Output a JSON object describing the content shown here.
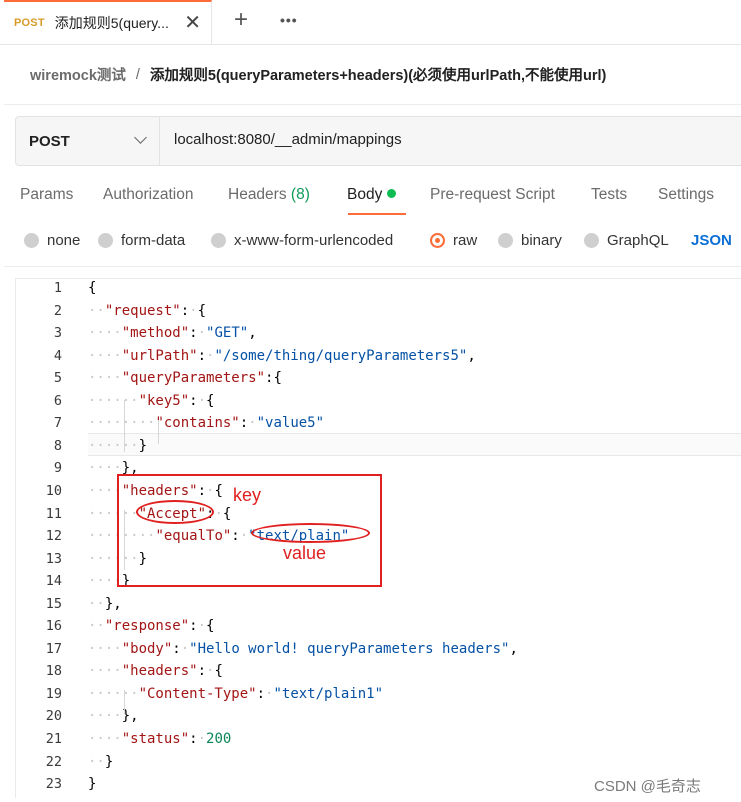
{
  "tab": {
    "method": "POST",
    "title": "添加规则5(query..."
  },
  "breadcrumb": {
    "parent": "wiremock测试",
    "separator": "/",
    "current": "添加规则5(queryParameters+headers)(必须使用urlPath,不能使用url)"
  },
  "request": {
    "method": "POST",
    "url": "localhost:8080/__admin/mappings"
  },
  "request_tabs": [
    {
      "label": "Params"
    },
    {
      "label": "Authorization"
    },
    {
      "label": "Headers",
      "count": "(8)"
    },
    {
      "label": "Body",
      "active": true
    },
    {
      "label": "Pre-request Script"
    },
    {
      "label": "Tests"
    },
    {
      "label": "Settings"
    }
  ],
  "body_types": [
    {
      "label": "none",
      "selected": false
    },
    {
      "label": "form-data",
      "selected": false
    },
    {
      "label": "x-www-form-urlencoded",
      "selected": false
    },
    {
      "label": "raw",
      "selected": true
    },
    {
      "label": "binary",
      "selected": false
    },
    {
      "label": "GraphQL",
      "selected": false
    }
  ],
  "raw_format": "JSON",
  "code_lines": [
    "{",
    "  \"request\": {",
    "    \"method\": \"GET\",",
    "    \"urlPath\": \"/some/thing/queryParameters5\",",
    "    \"queryParameters\":{",
    "      \"key5\": {",
    "        \"contains\": \"value5\"",
    "      }",
    "    },",
    "    \"headers\": {",
    "      \"Accept\": {",
    "        \"equalTo\": \"text/plain\"",
    "      }",
    "    }",
    "  },",
    "  \"response\": {",
    "    \"body\": \"Hello world! queryParameters headers\",",
    "    \"headers\": {",
    "      \"Content-Type\": \"text/plain1\"",
    "    },",
    "    \"status\": 200",
    "  }",
    "}"
  ],
  "annotations": {
    "key_label": "key",
    "value_label": "value"
  },
  "watermark": "CSDN @毛奇志",
  "colors": {
    "accent": "#ff6c37",
    "body_dot": "#0cbb52",
    "json_key": "#a31515",
    "json_string": "#0451a5",
    "json_number": "#098658",
    "annotation": "#e02020",
    "json_link": "#0b6fd6"
  },
  "icons": {
    "tab_close": "close-icon",
    "new_tab": "plus-icon",
    "more": "more-icon",
    "method_dropdown": "chevron-down-icon"
  }
}
